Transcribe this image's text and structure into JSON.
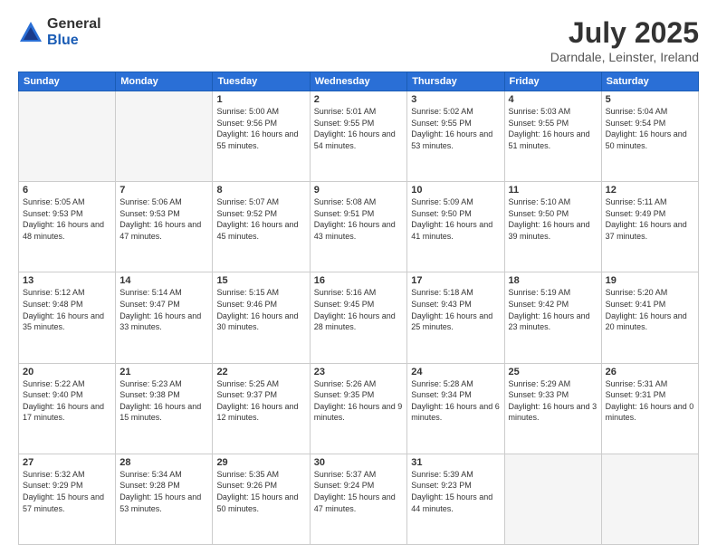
{
  "header": {
    "logo_general": "General",
    "logo_blue": "Blue",
    "month_title": "July 2025",
    "location": "Darndale, Leinster, Ireland"
  },
  "days_of_week": [
    "Sunday",
    "Monday",
    "Tuesday",
    "Wednesday",
    "Thursday",
    "Friday",
    "Saturday"
  ],
  "weeks": [
    [
      {
        "day": "",
        "empty": true
      },
      {
        "day": "",
        "empty": true
      },
      {
        "day": "1",
        "sunrise": "5:00 AM",
        "sunset": "9:56 PM",
        "daylight": "16 hours and 55 minutes."
      },
      {
        "day": "2",
        "sunrise": "5:01 AM",
        "sunset": "9:55 PM",
        "daylight": "16 hours and 54 minutes."
      },
      {
        "day": "3",
        "sunrise": "5:02 AM",
        "sunset": "9:55 PM",
        "daylight": "16 hours and 53 minutes."
      },
      {
        "day": "4",
        "sunrise": "5:03 AM",
        "sunset": "9:55 PM",
        "daylight": "16 hours and 51 minutes."
      },
      {
        "day": "5",
        "sunrise": "5:04 AM",
        "sunset": "9:54 PM",
        "daylight": "16 hours and 50 minutes."
      }
    ],
    [
      {
        "day": "6",
        "sunrise": "5:05 AM",
        "sunset": "9:53 PM",
        "daylight": "16 hours and 48 minutes."
      },
      {
        "day": "7",
        "sunrise": "5:06 AM",
        "sunset": "9:53 PM",
        "daylight": "16 hours and 47 minutes."
      },
      {
        "day": "8",
        "sunrise": "5:07 AM",
        "sunset": "9:52 PM",
        "daylight": "16 hours and 45 minutes."
      },
      {
        "day": "9",
        "sunrise": "5:08 AM",
        "sunset": "9:51 PM",
        "daylight": "16 hours and 43 minutes."
      },
      {
        "day": "10",
        "sunrise": "5:09 AM",
        "sunset": "9:50 PM",
        "daylight": "16 hours and 41 minutes."
      },
      {
        "day": "11",
        "sunrise": "5:10 AM",
        "sunset": "9:50 PM",
        "daylight": "16 hours and 39 minutes."
      },
      {
        "day": "12",
        "sunrise": "5:11 AM",
        "sunset": "9:49 PM",
        "daylight": "16 hours and 37 minutes."
      }
    ],
    [
      {
        "day": "13",
        "sunrise": "5:12 AM",
        "sunset": "9:48 PM",
        "daylight": "16 hours and 35 minutes."
      },
      {
        "day": "14",
        "sunrise": "5:14 AM",
        "sunset": "9:47 PM",
        "daylight": "16 hours and 33 minutes."
      },
      {
        "day": "15",
        "sunrise": "5:15 AM",
        "sunset": "9:46 PM",
        "daylight": "16 hours and 30 minutes."
      },
      {
        "day": "16",
        "sunrise": "5:16 AM",
        "sunset": "9:45 PM",
        "daylight": "16 hours and 28 minutes."
      },
      {
        "day": "17",
        "sunrise": "5:18 AM",
        "sunset": "9:43 PM",
        "daylight": "16 hours and 25 minutes."
      },
      {
        "day": "18",
        "sunrise": "5:19 AM",
        "sunset": "9:42 PM",
        "daylight": "16 hours and 23 minutes."
      },
      {
        "day": "19",
        "sunrise": "5:20 AM",
        "sunset": "9:41 PM",
        "daylight": "16 hours and 20 minutes."
      }
    ],
    [
      {
        "day": "20",
        "sunrise": "5:22 AM",
        "sunset": "9:40 PM",
        "daylight": "16 hours and 17 minutes."
      },
      {
        "day": "21",
        "sunrise": "5:23 AM",
        "sunset": "9:38 PM",
        "daylight": "16 hours and 15 minutes."
      },
      {
        "day": "22",
        "sunrise": "5:25 AM",
        "sunset": "9:37 PM",
        "daylight": "16 hours and 12 minutes."
      },
      {
        "day": "23",
        "sunrise": "5:26 AM",
        "sunset": "9:35 PM",
        "daylight": "16 hours and 9 minutes."
      },
      {
        "day": "24",
        "sunrise": "5:28 AM",
        "sunset": "9:34 PM",
        "daylight": "16 hours and 6 minutes."
      },
      {
        "day": "25",
        "sunrise": "5:29 AM",
        "sunset": "9:33 PM",
        "daylight": "16 hours and 3 minutes."
      },
      {
        "day": "26",
        "sunrise": "5:31 AM",
        "sunset": "9:31 PM",
        "daylight": "16 hours and 0 minutes."
      }
    ],
    [
      {
        "day": "27",
        "sunrise": "5:32 AM",
        "sunset": "9:29 PM",
        "daylight": "15 hours and 57 minutes."
      },
      {
        "day": "28",
        "sunrise": "5:34 AM",
        "sunset": "9:28 PM",
        "daylight": "15 hours and 53 minutes."
      },
      {
        "day": "29",
        "sunrise": "5:35 AM",
        "sunset": "9:26 PM",
        "daylight": "15 hours and 50 minutes."
      },
      {
        "day": "30",
        "sunrise": "5:37 AM",
        "sunset": "9:24 PM",
        "daylight": "15 hours and 47 minutes."
      },
      {
        "day": "31",
        "sunrise": "5:39 AM",
        "sunset": "9:23 PM",
        "daylight": "15 hours and 44 minutes."
      },
      {
        "day": "",
        "empty": true
      },
      {
        "day": "",
        "empty": true
      }
    ]
  ]
}
